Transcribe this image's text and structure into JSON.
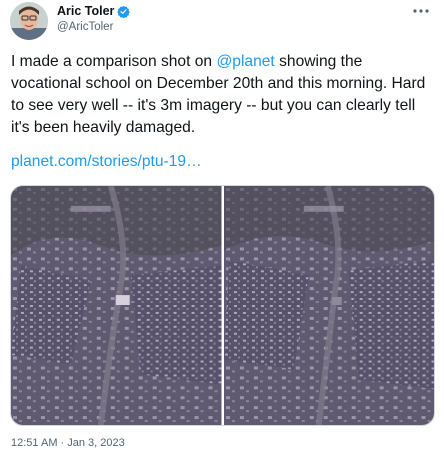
{
  "author": {
    "name": "Aric Toler",
    "handle": "@AricToler",
    "verified_icon": "verified-badge-icon",
    "verified_color": "#1d9bf0"
  },
  "tweet": {
    "text_before": "I made a comparison shot on ",
    "mention": "@planet",
    "text_after": " showing the vocational school on December 20th and this morning. Hard to see very well -- it's 3m imagery -- but you can clearly tell it's been heavily damaged.",
    "link": "planet.com/stories/ptu-19…",
    "link_color": "#1d9bf0"
  },
  "media": {
    "images": [
      "satellite-image-before",
      "satellite-image-after"
    ]
  },
  "meta": {
    "timestamp": "12:51 AM · Jan 3, 2023"
  },
  "icons": {
    "more": "more-options-icon"
  }
}
